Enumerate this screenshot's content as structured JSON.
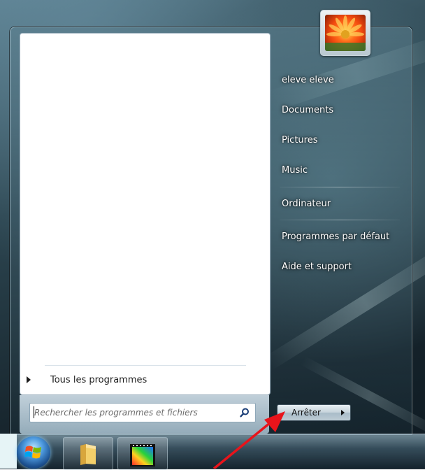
{
  "start_menu": {
    "all_programs_label": "Tous les programmes",
    "search_placeholder": "Rechercher les programmes et fichiers",
    "right_links": [
      {
        "label": "eleve eleve"
      },
      {
        "label": "Documents"
      },
      {
        "label": "Pictures"
      },
      {
        "label": "Music"
      },
      {
        "label": "Ordinateur"
      },
      {
        "label": "Programmes par défaut"
      },
      {
        "label": "Aide et support"
      }
    ],
    "shutdown_label": "Arrêter"
  },
  "icons": {
    "search": "search-icon",
    "start": "windows-start-icon",
    "explorer": "folder-icon",
    "movie_maker": "movie-maker-icon",
    "user_picture": "flower-picture"
  },
  "colors": {
    "annotation_arrow": "#e8141b",
    "link_text": "#ffffff"
  }
}
